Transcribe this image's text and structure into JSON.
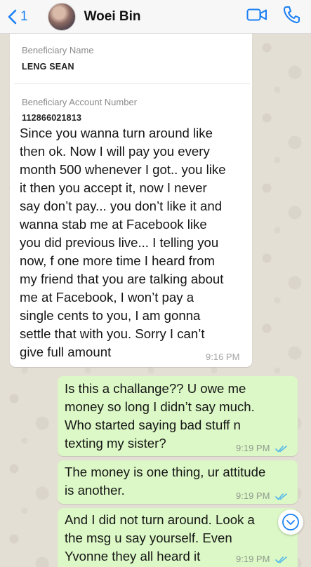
{
  "header": {
    "back_count": "1",
    "contact_name": "Woei Bin"
  },
  "messages": [
    {
      "direction": "incoming",
      "quote": {
        "name_label": "Beneficiary Name",
        "name_value": "LENG SEAN",
        "account_label": "Beneficiary Account Number",
        "account_value": "112866021813"
      },
      "lines": [
        "Since you wanna turn around like",
        "then ok. Now I will pay you every",
        "month 500 whenever I got.. you like",
        "it then you accept it, now I never",
        "say don’t pay... you don’t like it and",
        "wanna stab me at Facebook like",
        "you did previous live... I telling you",
        "now, f one more time I heard from",
        "my friend that you are talking about",
        "me at Facebook, I won’t pay a",
        "single cents to you, I am gonna",
        "settle that with you. Sorry I can’t",
        "give full amount"
      ],
      "time": "9:16 PM"
    },
    {
      "direction": "outgoing",
      "lines": [
        "Is this a challange?? U owe me",
        "money so long I didn’t say much.",
        "Who started saying bad stuff n",
        "texting my sister?"
      ],
      "time": "9:19 PM",
      "status": "read"
    },
    {
      "direction": "outgoing",
      "lines": [
        "The money is one thing, ur attitude",
        "is another."
      ],
      "time": "9:19 PM",
      "status": "read"
    },
    {
      "direction": "outgoing",
      "lines": [
        "And I did not turn around. Look a",
        "the msg u say yourself. Even",
        "Yvonne they all heard it"
      ],
      "time": "9:19 PM",
      "status": "read"
    }
  ],
  "colors": {
    "accent": "#1a7ff5",
    "read_ticks": "#4fb6ec",
    "outgoing_bubble": "#dcf8c6",
    "incoming_bubble": "#ffffff"
  },
  "icons": [
    "chevron-left-icon",
    "video-call-icon",
    "phone-icon",
    "double-check-icon",
    "chevron-down-icon"
  ]
}
